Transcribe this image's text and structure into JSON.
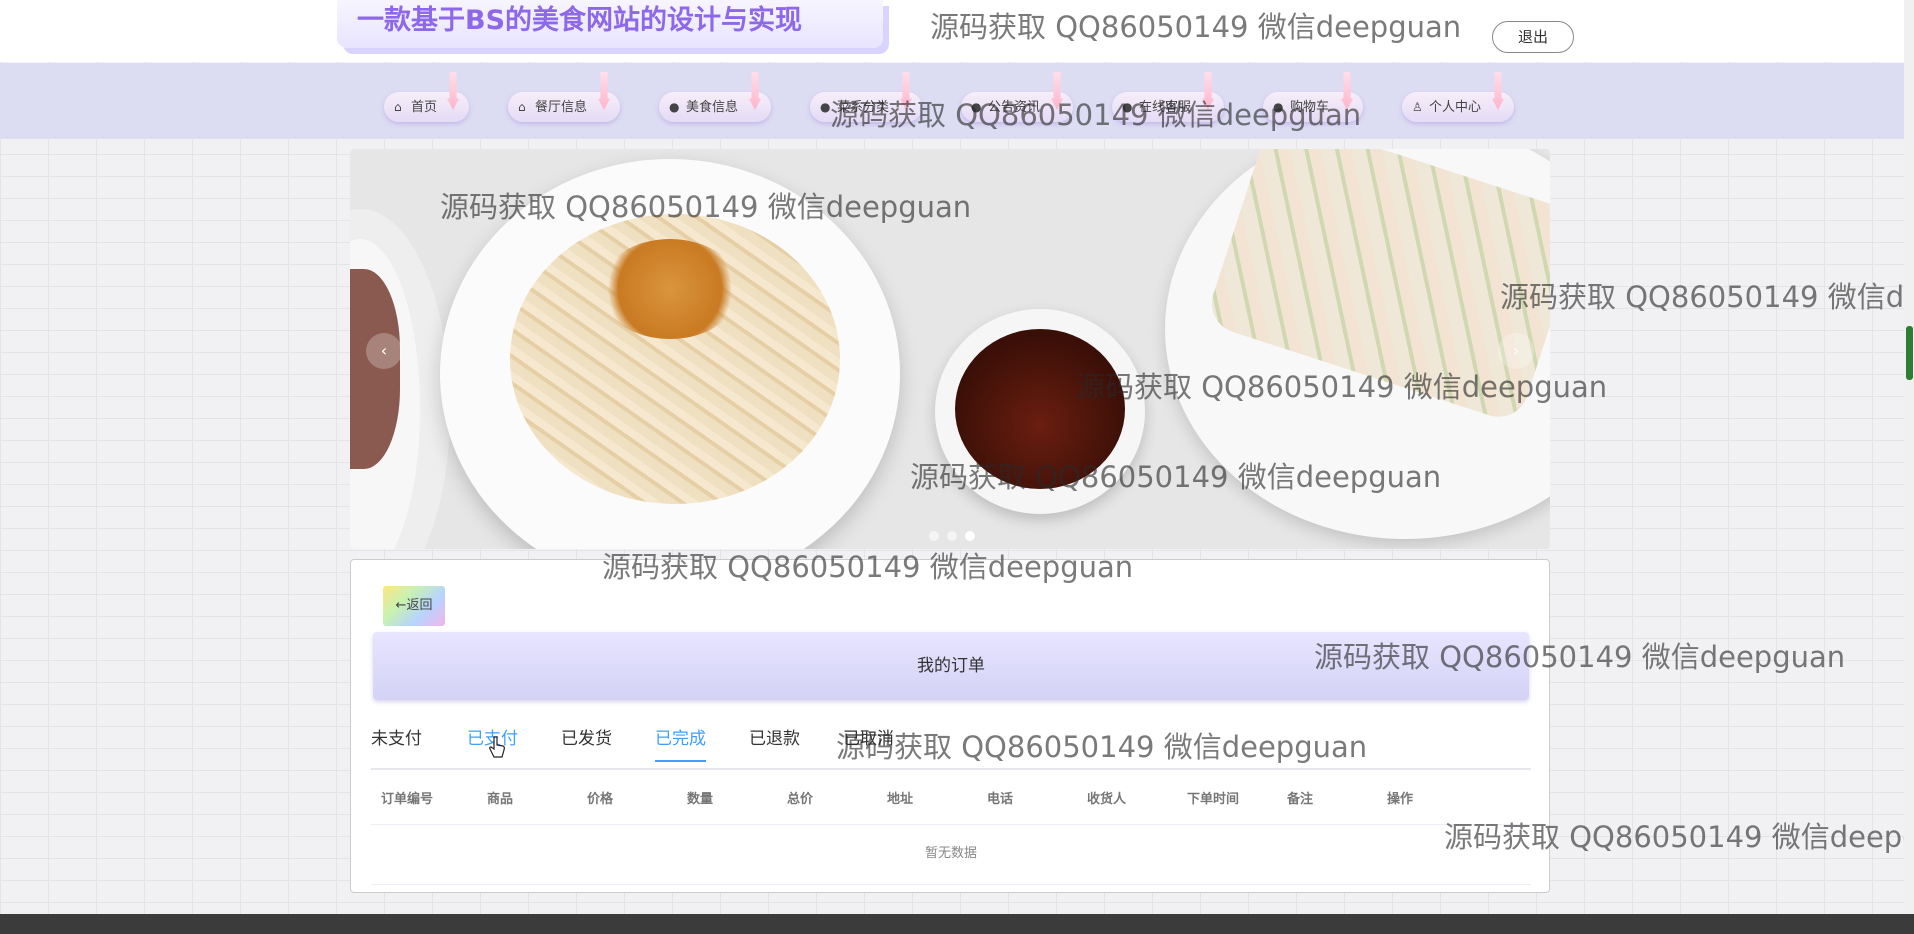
{
  "header": {
    "site_title": "一款基于BS的美食网站的设计与实现",
    "logout_label": "退出"
  },
  "nav": {
    "items": [
      {
        "icon": "home-icon",
        "glyph": "⌂",
        "label": "首页"
      },
      {
        "icon": "store-icon",
        "glyph": "⌂",
        "label": "餐厅信息"
      },
      {
        "icon": "info-icon",
        "glyph": "●",
        "label": "美食信息"
      },
      {
        "icon": "info-icon",
        "glyph": "●",
        "label": "菜系分类"
      },
      {
        "icon": "info-icon",
        "glyph": "●",
        "label": "公告资讯"
      },
      {
        "icon": "info-icon",
        "glyph": "●",
        "label": "在线客服"
      },
      {
        "icon": "cart-icon",
        "glyph": "●",
        "label": "购物车"
      },
      {
        "icon": "user-icon",
        "glyph": "♙",
        "label": "个人中心"
      }
    ]
  },
  "banner": {
    "prev_icon": "‹",
    "next_icon": "›",
    "slide_count": 3,
    "active_slide": 3
  },
  "orders": {
    "back_label": "←返回",
    "title": "我的订单",
    "tabs": [
      "未支付",
      "已支付",
      "已发货",
      "已完成",
      "已退款",
      "已取消"
    ],
    "active_tab": "已完成",
    "hovered_tab": "已支付",
    "columns": [
      "订单编号",
      "商品",
      "价格",
      "数量",
      "总价",
      "地址",
      "电话",
      "收货人",
      "下单时间",
      "备注",
      "操作"
    ],
    "empty_text": "暂无数据"
  },
  "watermark": {
    "text": "源码获取 QQ86050149 微信deepguan"
  },
  "colors": {
    "accent": "#409eff",
    "title_purple": "#8d68e8",
    "nav_bg": "#dcdcf3"
  }
}
